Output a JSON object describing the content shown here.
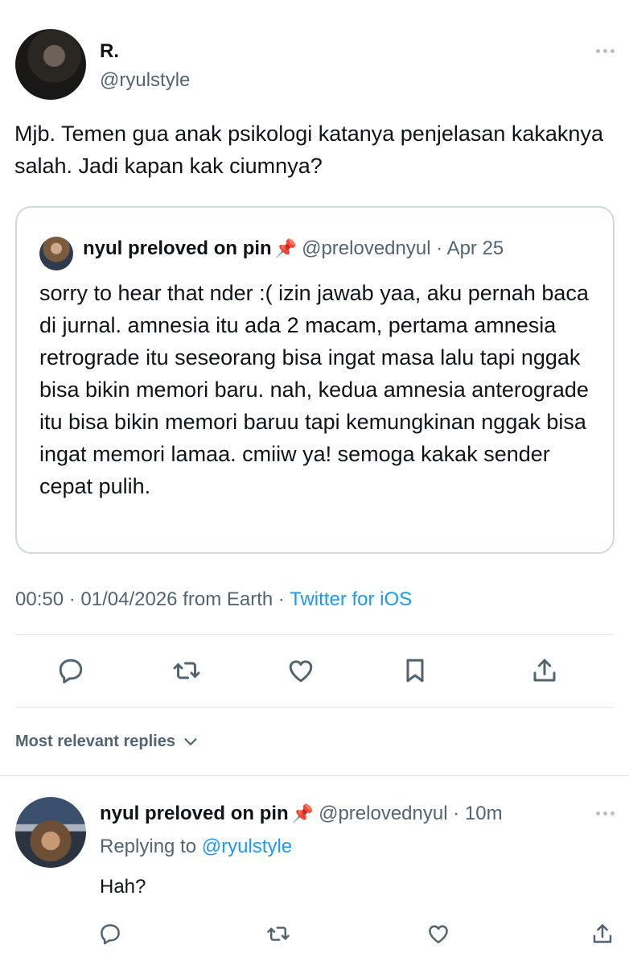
{
  "tweet": {
    "author_name": "R.",
    "author_handle": "@ryulstyle",
    "text": "Mjb. Temen gua anak psikologi katanya penjelasan kakaknya salah. Jadi kapan kak ciumnya?",
    "quoted": {
      "author_name": "nyul preloved on pin",
      "emoji": "📌",
      "author_handle": "@prelovednyul",
      "separator": "·",
      "date": "Apr 25",
      "text": "sorry to hear that nder :( izin jawab yaa, aku pernah baca di jurnal. amnesia itu ada 2 macam, pertama amnesia retrograde itu seseorang bisa ingat masa lalu tapi nggak bisa bikin memori baru. nah, kedua amnesia anterograde itu bisa bikin memori baruu tapi kemungkinan nggak bisa ingat memori lamaa. cmiiw ya! semoga kakak sender cepat pulih."
    },
    "meta": {
      "time": "00:50",
      "separator": "·",
      "date": "01/04/2026",
      "location": "from Earth",
      "source": "Twitter for iOS"
    },
    "actions": [
      "reply-icon",
      "retweet-icon",
      "like-icon",
      "bookmark-icon",
      "share-icon"
    ]
  },
  "replies": {
    "header_label": "Most relevant replies",
    "items": [
      {
        "author_name": "nyul preloved on pin",
        "emoji": "📌",
        "author_handle": "@prelovednyul",
        "separator": "·",
        "time": "10m",
        "replying_to_label": "Replying to",
        "replying_to_handle": "@ryulstyle",
        "text": "Hah?"
      }
    ]
  },
  "colors": {
    "text": "#0f1419",
    "muted": "#536471",
    "link": "#1d9bf0",
    "border": "#cfd9de"
  }
}
